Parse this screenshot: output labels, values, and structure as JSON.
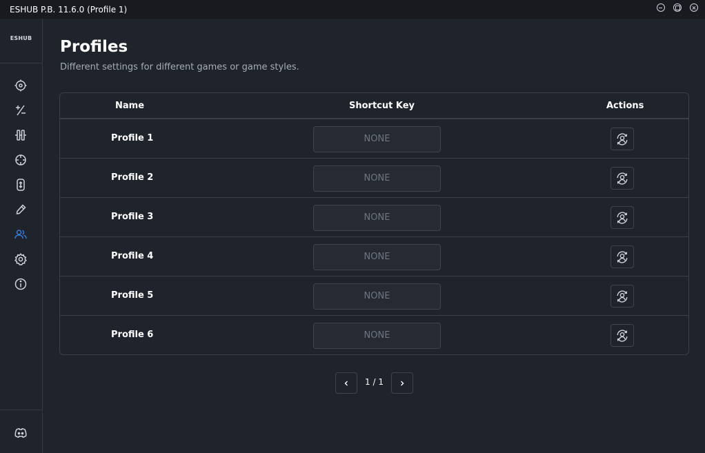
{
  "window": {
    "title": "ESHUB P.B. 11.6.0 (Profile 1)"
  },
  "sidebar": {
    "logo_text": "ESHUB",
    "items": [
      {
        "name": "target",
        "icon": "crosshair-target-icon",
        "active": false
      },
      {
        "name": "plus-minus",
        "icon": "plus-minus-icon",
        "active": false
      },
      {
        "name": "equalizer",
        "icon": "column-sliders-icon",
        "active": false
      },
      {
        "name": "crosshair",
        "icon": "crosshair-icon",
        "active": false
      },
      {
        "name": "mouse",
        "icon": "mouse-scroll-icon",
        "active": false
      },
      {
        "name": "color-picker",
        "icon": "eyedropper-icon",
        "active": false
      },
      {
        "name": "profiles",
        "icon": "users-icon",
        "active": true
      },
      {
        "name": "settings",
        "icon": "gear-icon",
        "active": false
      },
      {
        "name": "about",
        "icon": "info-icon",
        "active": false
      }
    ],
    "bottom": {
      "icon": "discord-icon"
    }
  },
  "colors": {
    "accent": "#3a7bd5",
    "icon": "#cfd3da"
  },
  "page": {
    "title": "Profiles",
    "subtitle": "Different settings for different games or game styles."
  },
  "table": {
    "headers": {
      "name": "Name",
      "shortcut": "Shortcut Key",
      "actions": "Actions"
    },
    "rows": [
      {
        "name": "Profile 1",
        "shortcut": "NONE"
      },
      {
        "name": "Profile 2",
        "shortcut": "NONE"
      },
      {
        "name": "Profile 3",
        "shortcut": "NONE"
      },
      {
        "name": "Profile 4",
        "shortcut": "NONE"
      },
      {
        "name": "Profile 5",
        "shortcut": "NONE"
      },
      {
        "name": "Profile 6",
        "shortcut": "NONE"
      }
    ],
    "action_icon": "profile-sync-icon"
  },
  "pagination": {
    "text": "1 / 1"
  }
}
